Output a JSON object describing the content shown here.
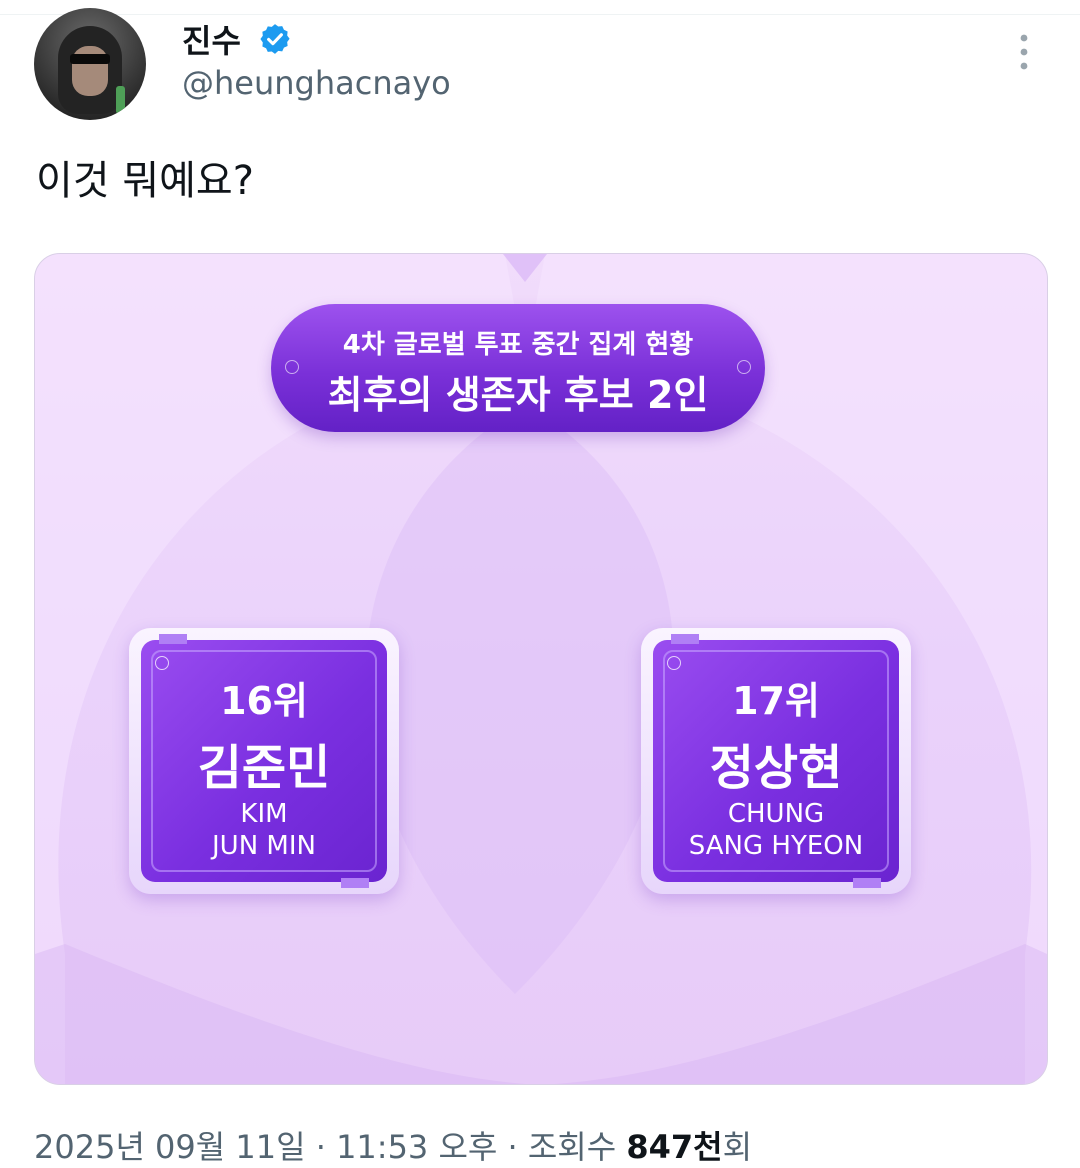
{
  "user": {
    "display_name": "진수",
    "handle": "@heunghacnayo"
  },
  "tweet": {
    "text": "이것 뭐예요?"
  },
  "media": {
    "header": {
      "subtitle": "4차 글로벌 투표 중간 집계 현황",
      "title": "최후의 생존자 후보 2인"
    },
    "candidates": [
      {
        "rank": "16위",
        "name_ko": "김준민",
        "name_en_line1": "KIM",
        "name_en_line2": "JUN MIN"
      },
      {
        "rank": "17위",
        "name_ko": "정상현",
        "name_en_line1": "CHUNG",
        "name_en_line2": "SANG HYEON"
      }
    ]
  },
  "meta": {
    "date": "2025년 09월 11일",
    "separator1": " · ",
    "time": "11:53 오후",
    "separator2": " · ",
    "views_label": "조회수 ",
    "views_value": "847천",
    "views_suffix": "회"
  },
  "icons": {
    "verified": "verified-badge-icon",
    "more": "more-options-icon"
  },
  "colors": {
    "verified_blue": "#1d9bf0",
    "secondary_text": "#536471",
    "accent_purple": "#7a30d8"
  }
}
